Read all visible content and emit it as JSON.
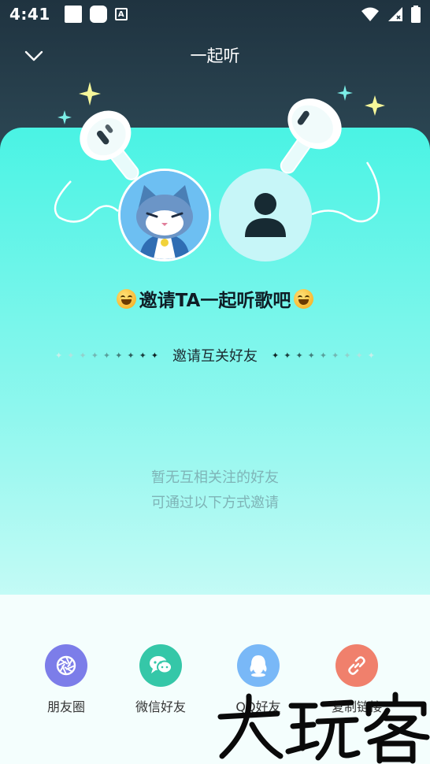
{
  "status_bar": {
    "time": "4:41",
    "notification_icons": [
      "square-icon",
      "rounded-square-icon",
      "text-a-icon"
    ],
    "system_icons": [
      "wifi-icon",
      "signal-icon",
      "battery-icon"
    ]
  },
  "header": {
    "title": "一起听",
    "back_icon": "chevron-down-icon"
  },
  "invite": {
    "title": "邀请TA一起听歌吧"
  },
  "section": {
    "label": "邀请互关好友"
  },
  "empty_state": {
    "line1": "暂无互相关注的好友",
    "line2": "可通过以下方式邀请"
  },
  "share_options": [
    {
      "label": "朋友圈",
      "color": "#7c7de9",
      "icon": "aperture-icon"
    },
    {
      "label": "微信好友",
      "color": "#35c7a8",
      "icon": "chat-bubble-icon"
    },
    {
      "label": "QQ好友",
      "color": "#79b8f7",
      "icon": "qq-penguin-icon"
    },
    {
      "label": "复制链接",
      "color": "#f0806c",
      "icon": "link-icon"
    }
  ],
  "watermark": {
    "text": "大玩客"
  },
  "colors": {
    "card_top": "#4af3e4",
    "card_bottom": "#f2fffd",
    "header_bg": "#1f3340"
  }
}
